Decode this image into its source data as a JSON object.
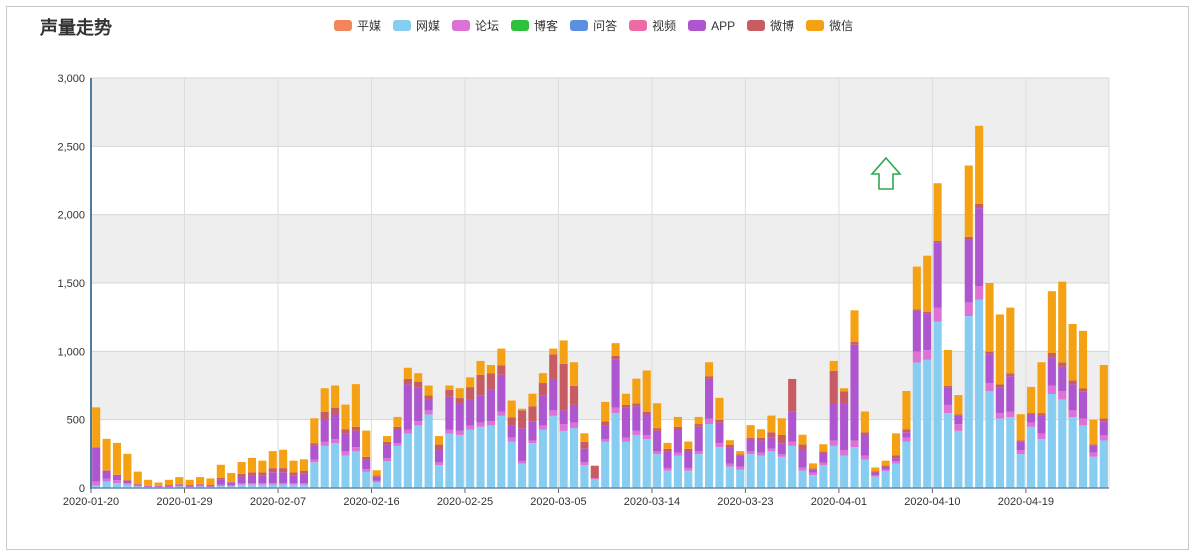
{
  "title": "声量走势",
  "colors": {
    "平媒": "#f3855a",
    "网媒": "#87cdf1",
    "论坛": "#dc72d6",
    "博客": "#2ec13c",
    "问答": "#5b8fe0",
    "视频": "#ee6ca6",
    "APP": "#ae56d0",
    "微博": "#c75c62",
    "微信": "#f4a214"
  },
  "chart_data": {
    "type": "bar",
    "stacked": true,
    "title": "声量走势",
    "ylim": [
      0,
      3000
    ],
    "yticks": [
      "0",
      "500",
      "1,000",
      "1,500",
      "2,000",
      "2,500",
      "3,000"
    ],
    "xticks": [
      {
        "index": 0,
        "label": "2020-01-20"
      },
      {
        "index": 9,
        "label": "2020-01-29"
      },
      {
        "index": 18,
        "label": "2020-02-07"
      },
      {
        "index": 27,
        "label": "2020-02-16"
      },
      {
        "index": 36,
        "label": "2020-02-25"
      },
      {
        "index": 45,
        "label": "2020-03-05"
      },
      {
        "index": 54,
        "label": "2020-03-14"
      },
      {
        "index": 63,
        "label": "2020-03-23"
      },
      {
        "index": 72,
        "label": "2020-04-01"
      },
      {
        "index": 81,
        "label": "2020-04-10"
      },
      {
        "index": 90,
        "label": "2020-04-19"
      }
    ],
    "series_names": [
      "平媒",
      "网媒",
      "论坛",
      "博客",
      "问答",
      "视频",
      "APP",
      "微博",
      "微信"
    ],
    "totals": [
      590,
      360,
      330,
      250,
      120,
      60,
      40,
      60,
      80,
      60,
      80,
      70,
      170,
      110,
      190,
      220,
      200,
      270,
      280,
      200,
      210,
      510,
      730,
      750,
      610,
      760,
      420,
      130,
      380,
      520,
      880,
      840,
      750,
      380,
      750,
      730,
      810,
      930,
      900,
      1020,
      640,
      580,
      690,
      840,
      1020,
      1080,
      920,
      400,
      160,
      630,
      1060,
      690,
      800,
      860,
      620,
      330,
      520,
      340,
      520,
      920,
      660,
      350,
      270,
      460,
      430,
      530,
      510,
      770,
      390,
      180,
      320,
      930,
      730,
      1300,
      560,
      150,
      200,
      400,
      710,
      1620,
      1700,
      2230,
      1010,
      680,
      2360,
      2650,
      1500,
      1270,
      1320,
      540,
      740,
      920,
      1440,
      1510,
      1200,
      1150,
      500,
      900
    ],
    "web": [
      10,
      40,
      30,
      20,
      10,
      5,
      5,
      5,
      10,
      5,
      10,
      5,
      10,
      10,
      20,
      20,
      20,
      20,
      20,
      20,
      20,
      180,
      300,
      320,
      230,
      260,
      110,
      40,
      190,
      300,
      390,
      450,
      530,
      160,
      390,
      380,
      420,
      440,
      450,
      520,
      330,
      170,
      320,
      420,
      520,
      410,
      430,
      160,
      60,
      330,
      540,
      330,
      380,
      350,
      240,
      120,
      230,
      120,
      240,
      460,
      290,
      150,
      130,
      240,
      230,
      260,
      220,
      300,
      120,
      90,
      160,
      300,
      230,
      290,
      200,
      80,
      120,
      170,
      330,
      910,
      930,
      1210,
      540,
      410,
      1250,
      1370,
      700,
      500,
      510,
      240,
      440,
      350,
      680,
      640,
      510,
      450,
      220,
      340
    ],
    "forum": [
      30,
      20,
      20,
      10,
      5,
      5,
      5,
      5,
      5,
      5,
      5,
      5,
      10,
      10,
      10,
      10,
      10,
      10,
      10,
      10,
      10,
      20,
      30,
      30,
      30,
      30,
      20,
      10,
      20,
      20,
      30,
      30,
      30,
      20,
      30,
      30,
      30,
      30,
      30,
      30,
      30,
      20,
      20,
      30,
      40,
      50,
      40,
      20,
      10,
      20,
      40,
      30,
      30,
      30,
      20,
      20,
      20,
      20,
      20,
      40,
      30,
      20,
      20,
      20,
      20,
      20,
      20,
      30,
      20,
      20,
      20,
      40,
      40,
      50,
      30,
      10,
      10,
      20,
      30,
      80,
      70,
      100,
      60,
      50,
      100,
      100,
      60,
      40,
      40,
      30,
      30,
      40,
      60,
      60,
      50,
      50,
      30,
      40
    ],
    "app": [
      250,
      60,
      40,
      20,
      10,
      5,
      5,
      10,
      10,
      10,
      10,
      10,
      40,
      20,
      50,
      60,
      60,
      80,
      80,
      60,
      70,
      100,
      160,
      180,
      130,
      120,
      70,
      30,
      100,
      100,
      330,
      250,
      80,
      90,
      240,
      200,
      190,
      200,
      230,
      270,
      90,
      240,
      140,
      220,
      230,
      100,
      130,
      100,
      0,
      100,
      350,
      220,
      180,
      150,
      150,
      120,
      170,
      120,
      180,
      290,
      150,
      120,
      80,
      90,
      90,
      80,
      80,
      220,
      130,
      20,
      70,
      270,
      340,
      700,
      150,
      20,
      20,
      20,
      40,
      300,
      270,
      480,
      130,
      60,
      460,
      570,
      210,
      190,
      260,
      60,
      60,
      130,
      210,
      180,
      190,
      200,
      50,
      100
    ],
    "weibo": [
      0,
      0,
      0,
      0,
      0,
      0,
      0,
      0,
      0,
      0,
      0,
      0,
      10,
      0,
      20,
      20,
      20,
      30,
      30,
      20,
      20,
      20,
      60,
      50,
      30,
      30,
      20,
      10,
      20,
      20,
      40,
      40,
      30,
      40,
      50,
      40,
      90,
      150,
      120,
      70,
      60,
      130,
      110,
      90,
      180,
      340,
      140,
      50,
      90,
      30,
      30,
      20,
      20,
      20,
      20,
      20,
      20,
      20,
      20,
      20,
      20,
      20,
      10,
      10,
      20,
      40,
      60,
      240,
      40,
      10,
      10,
      240,
      90,
      20,
      20,
      10,
      10,
      20,
      20,
      10,
      10,
      10,
      10,
      10,
      20,
      30,
      20,
      20,
      20,
      10,
      10,
      20,
      30,
      30,
      30,
      20,
      10,
      20
    ]
  },
  "watermark_arrow": "up-arrow-icon"
}
